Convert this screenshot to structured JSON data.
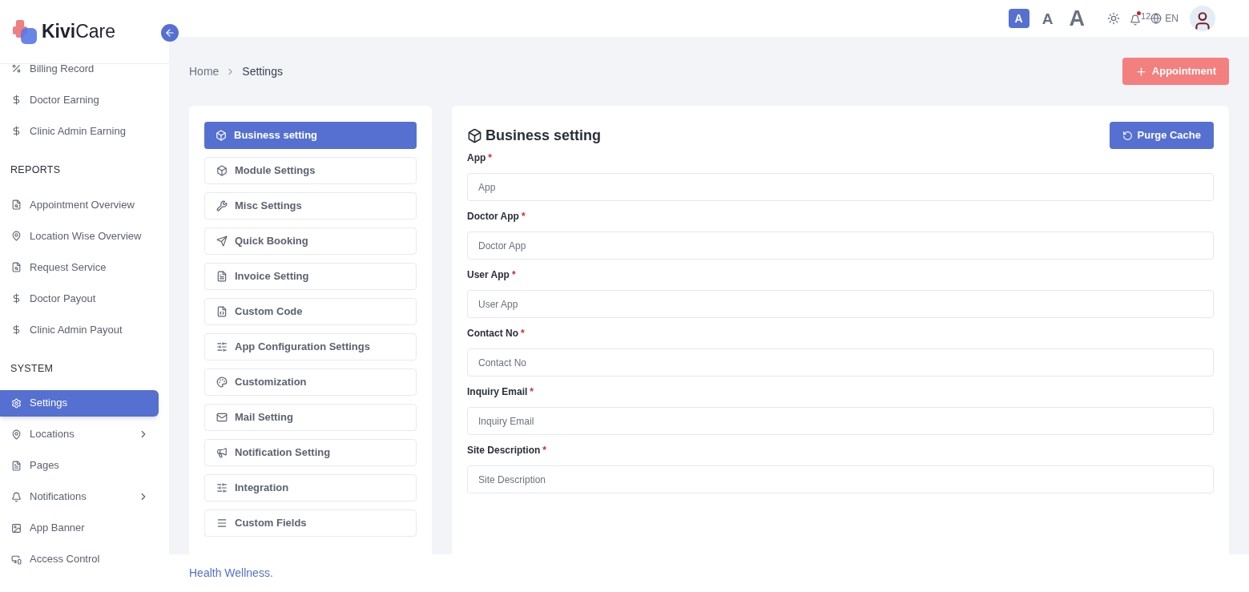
{
  "brand": {
    "name_bold": "Kivi",
    "name_rest": "Care"
  },
  "sidebar": {
    "sections": [
      {
        "items": [
          {
            "label": "Billing Record",
            "selected": false,
            "expandable": false
          },
          {
            "label": "Doctor Earning",
            "selected": false,
            "expandable": false
          },
          {
            "label": "Clinic Admin Earning",
            "selected": false,
            "expandable": false
          }
        ]
      },
      {
        "heading": "REPORTS",
        "items": [
          {
            "label": "Appointment Overview",
            "selected": false,
            "expandable": false
          },
          {
            "label": "Location Wise Overview",
            "selected": false,
            "expandable": false
          },
          {
            "label": "Request Service",
            "selected": false,
            "expandable": false
          },
          {
            "label": "Doctor Payout",
            "selected": false,
            "expandable": false
          },
          {
            "label": "Clinic Admin Payout",
            "selected": false,
            "expandable": false
          }
        ]
      },
      {
        "heading": "SYSTEM",
        "items": [
          {
            "label": "Settings",
            "selected": true,
            "expandable": false
          },
          {
            "label": "Locations",
            "selected": false,
            "expandable": true
          },
          {
            "label": "Pages",
            "selected": false,
            "expandable": false
          },
          {
            "label": "Notifications",
            "selected": false,
            "expandable": true
          },
          {
            "label": "App Banner",
            "selected": false,
            "expandable": false
          },
          {
            "label": "Access Control",
            "selected": false,
            "expandable": false
          }
        ]
      }
    ]
  },
  "header": {
    "font_sizes": [
      {
        "label": "A",
        "selected": true
      },
      {
        "label": "A",
        "selected": false
      },
      {
        "label": "A",
        "selected": false
      }
    ],
    "notification_count": "12",
    "unread": true,
    "language": "EN"
  },
  "breadcrumb": [
    "Home",
    "Settings"
  ],
  "appointment_button": "Appointment",
  "settings_menu": [
    {
      "label": "Business setting",
      "selected": true
    },
    {
      "label": "Module Settings",
      "selected": false
    },
    {
      "label": "Misc Settings",
      "selected": false
    },
    {
      "label": "Quick Booking",
      "selected": false
    },
    {
      "label": "Invoice Setting",
      "selected": false
    },
    {
      "label": "Custom Code",
      "selected": false
    },
    {
      "label": "App Configuration Settings",
      "selected": false
    },
    {
      "label": "Customization",
      "selected": false
    },
    {
      "label": "Mail Setting",
      "selected": false
    },
    {
      "label": "Notification Setting",
      "selected": false
    },
    {
      "label": "Integration",
      "selected": false
    },
    {
      "label": "Custom Fields",
      "selected": false
    }
  ],
  "panel": {
    "title": "Business setting",
    "purge_button": "Purge Cache",
    "fields": [
      {
        "label": "App",
        "required_mark": "*",
        "placeholder": "App"
      },
      {
        "label": "Doctor App",
        "required_mark": "*",
        "placeholder": "Doctor App"
      },
      {
        "label": "User App",
        "required_mark": "*",
        "placeholder": "User App"
      },
      {
        "label": "Contact No",
        "required_mark": "*",
        "placeholder": "Contact No"
      },
      {
        "label": "Inquiry Email",
        "required_mark": "*",
        "placeholder": "Inquiry Email"
      },
      {
        "label": "Site Description",
        "required_mark": "*",
        "placeholder": "Site Description"
      }
    ]
  },
  "footer": {
    "link": "Health Wellness."
  }
}
